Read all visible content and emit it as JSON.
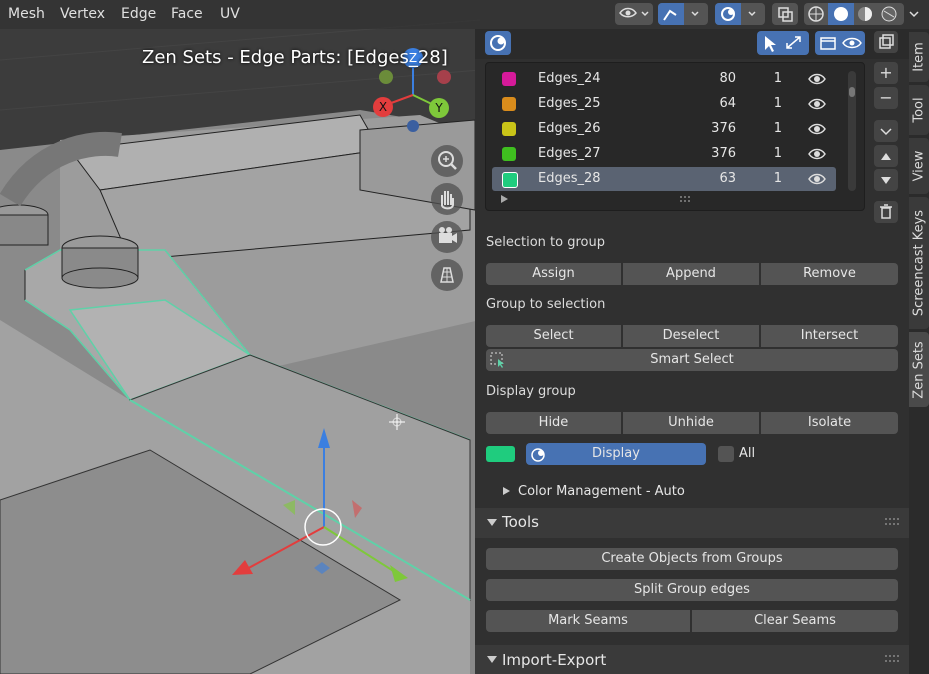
{
  "header": {
    "menus": [
      "Mesh",
      "Vertex",
      "Edge",
      "Face",
      "UV"
    ]
  },
  "viewport": {
    "title": "Zen Sets - Edge Parts: [Edges_28]",
    "axes": {
      "x": "X",
      "y": "Y",
      "z": "Z"
    }
  },
  "groups": [
    {
      "name": "Edges_24",
      "count": "80",
      "num": "1",
      "color": "#d61a9a"
    },
    {
      "name": "Edges_25",
      "count": "64",
      "num": "1",
      "color": "#d98c1c"
    },
    {
      "name": "Edges_26",
      "count": "376",
      "num": "1",
      "color": "#c9c418"
    },
    {
      "name": "Edges_27",
      "count": "376",
      "num": "1",
      "color": "#3fbf1f"
    },
    {
      "name": "Edges_28",
      "count": "63",
      "num": "1",
      "color": "#1fcc7e",
      "selected": true
    }
  ],
  "sections": {
    "selection_to_group": "Selection to group",
    "group_to_selection": "Group to selection",
    "display_group": "Display group",
    "color_management": "Color Management - Auto",
    "tools": "Tools",
    "import_export": "Import-Export"
  },
  "buttons": {
    "assign": "Assign",
    "append": "Append",
    "remove": "Remove",
    "select": "Select",
    "deselect": "Deselect",
    "intersect": "Intersect",
    "smart_select": "Smart Select",
    "hide": "Hide",
    "unhide": "Unhide",
    "isolate": "Isolate",
    "display": "Display",
    "all": "All",
    "create_objects": "Create Objects from Groups",
    "split_group_edges": "Split Group edges",
    "mark_seams": "Mark Seams",
    "clear_seams": "Clear Seams"
  },
  "tabs": [
    "Item",
    "Tool",
    "View",
    "Screencast Keys",
    "Zen Sets"
  ],
  "active_tab": "Zen Sets",
  "display_color": "#1fcc7e",
  "accent": "#4772b3"
}
